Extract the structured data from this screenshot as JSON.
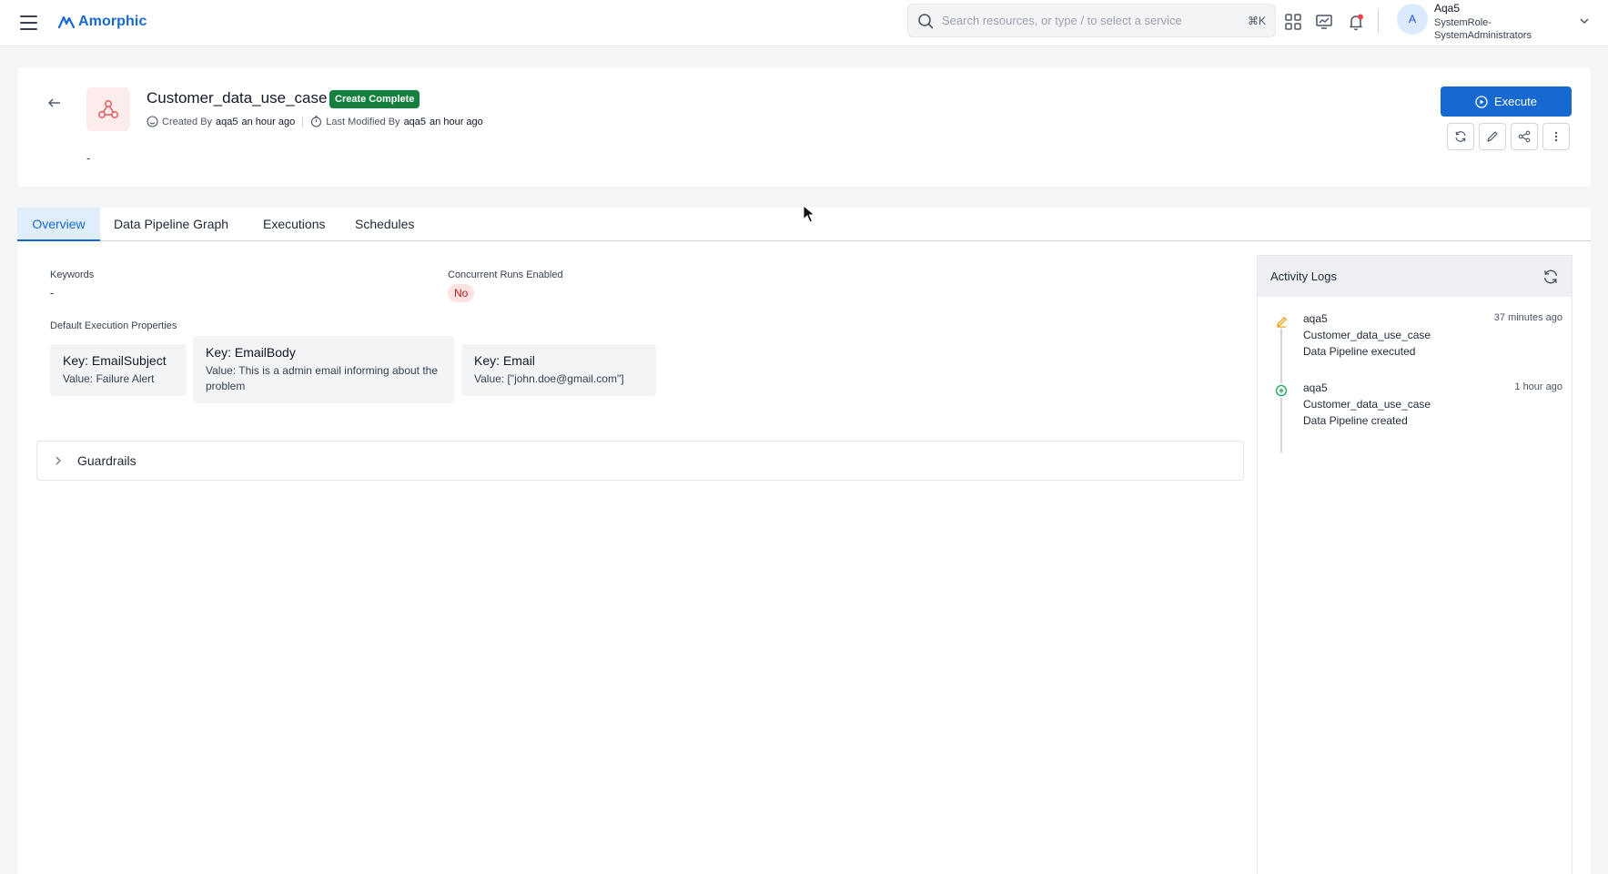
{
  "app": {
    "name": "Amorphic"
  },
  "search": {
    "placeholder": "Search resources, or type / to select a service",
    "shortcut": "⌘K"
  },
  "user": {
    "initial": "A",
    "name": "Aqa5",
    "role": "SystemRole-SystemAdministrators"
  },
  "pipeline": {
    "title": "Customer_data_use_case",
    "status": "Create Complete",
    "created_label": "Created By",
    "created_by": "aqa5",
    "created_time": "an hour ago",
    "modified_label": "Last Modified By",
    "modified_by": "aqa5",
    "modified_time": "an hour ago",
    "description": "-",
    "execute_label": "Execute"
  },
  "tabs": [
    {
      "label": "Overview",
      "active": true
    },
    {
      "label": "Data Pipeline Graph"
    },
    {
      "label": "Executions"
    },
    {
      "label": "Schedules"
    }
  ],
  "overview": {
    "keywords_label": "Keywords",
    "keywords_value": "-",
    "concurrent_label": "Concurrent Runs Enabled",
    "concurrent_value": "No",
    "props_label": "Default Execution Properties",
    "properties": [
      {
        "key": "Key: EmailSubject",
        "value": "Value: Failure Alert"
      },
      {
        "key": "Key: EmailBody",
        "value": "Value: This is a admin email informing about the problem"
      },
      {
        "key": "Key: Email",
        "value": "Value: [\"john.doe@gmail.com\"]"
      }
    ],
    "guardrails_label": "Guardrails"
  },
  "activity": {
    "title": "Activity Logs",
    "entries": [
      {
        "user": "aqa5",
        "resource": "Customer_data_use_case",
        "action": "Data Pipeline executed",
        "time": "37 minutes ago",
        "icon": "pencil-icon"
      },
      {
        "user": "aqa5",
        "resource": "Customer_data_use_case",
        "action": "Data Pipeline created",
        "time": "1 hour ago",
        "icon": "plus-circle-icon"
      }
    ]
  },
  "colors": {
    "accent": "#1769d2",
    "success": "#15803d",
    "danger": "#b91c1c",
    "pipeline_icon": "#e05a5a"
  }
}
